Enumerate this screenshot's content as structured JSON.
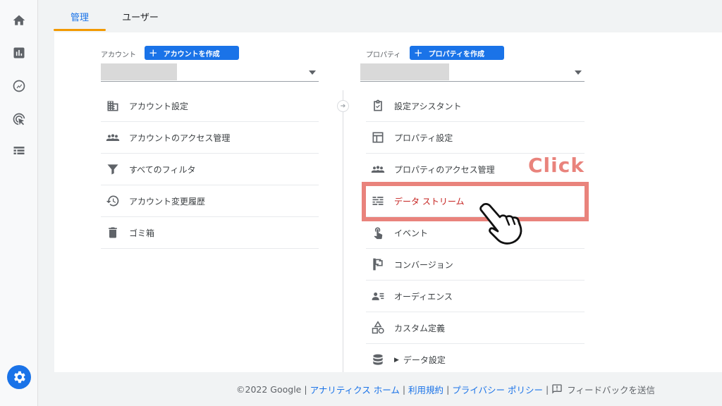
{
  "tabs": [
    {
      "label": "管理",
      "active": true
    },
    {
      "label": "ユーザー",
      "active": false
    }
  ],
  "rail_icons": [
    "home-icon",
    "bar-chart-icon",
    "explore-icon",
    "advertising-icon",
    "list-icon"
  ],
  "settings_icon": "gear-icon",
  "account": {
    "label": "アカウント",
    "create_button": "アカウントを作成",
    "items": [
      {
        "label": "アカウント設定",
        "icon": "building-icon"
      },
      {
        "label": "アカウントのアクセス管理",
        "icon": "people-icon"
      },
      {
        "label": "すべてのフィルタ",
        "icon": "filter-icon"
      },
      {
        "label": "アカウント変更履歴",
        "icon": "history-icon"
      },
      {
        "label": "ゴミ箱",
        "icon": "trash-icon"
      }
    ]
  },
  "property": {
    "label": "プロパティ",
    "create_button": "プロパティを作成",
    "items": [
      {
        "label": "設定アシスタント",
        "icon": "checklist-icon"
      },
      {
        "label": "プロパティ設定",
        "icon": "layout-icon"
      },
      {
        "label": "プロパティのアクセス管理",
        "icon": "people-icon"
      },
      {
        "label": "データ ストリーム",
        "icon": "streams-icon",
        "highlighted": true
      },
      {
        "label": "イベント",
        "icon": "touch-icon"
      },
      {
        "label": "コンバージョン",
        "icon": "flag-icon"
      },
      {
        "label": "オーディエンス",
        "icon": "audience-icon"
      },
      {
        "label": "カスタム定義",
        "icon": "shapes-icon"
      },
      {
        "label": "データ設定",
        "icon": "database-icon",
        "expandable": true
      }
    ]
  },
  "annotation": {
    "text": "Click",
    "color": "#e9837c"
  },
  "footer": {
    "copyright": "©2022 Google",
    "links": [
      "アナリティクス ホーム",
      "利用規約",
      "プライバシー ポリシー"
    ],
    "feedback": "フィードバックを送信"
  },
  "colors": {
    "accent": "#1a73e8",
    "tab_indicator": "#f29900",
    "highlight": "#c5221f"
  }
}
